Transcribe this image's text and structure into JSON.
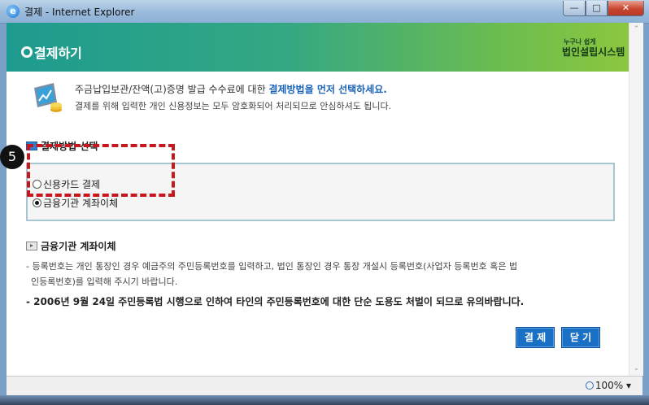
{
  "window": {
    "title": "결제 - Internet Explorer",
    "icon": "ie-icon",
    "controls": [
      "minimize-icon",
      "maximize-icon",
      "close-icon"
    ]
  },
  "header": {
    "title": "결제하기",
    "logo_small": "누구나 쉽게",
    "logo_main": "법인설립시스템"
  },
  "info": {
    "line1_prefix": "주금납입보관/잔액(고)증명 발급 수수료에 대한 ",
    "line1_highlight": "결제방법을 먼저 선택하세요.",
    "line2": "결제를 위해 입력한 개인 신용정보는 모두 암호화되어 처리되므로 안심하셔도 됩니다."
  },
  "payment_method": {
    "heading": "결제방법 선택",
    "options": [
      {
        "label": "신용카드 결제",
        "selected": false
      },
      {
        "label": "금융기관 계좌이체",
        "selected": true
      }
    ],
    "step_number": "5"
  },
  "transfer": {
    "heading": "금융기관 계좌이체",
    "desc_line1": "- 등록번호는 개인 통장인 경우 예금주의 주민등록번호를 입력하고, 법인 통장인 경우 통장 개설시 등록번호(사업자 등록번호 혹은 법",
    "desc_line2": "  인등록번호)를 입력해 주시기 바랍니다.",
    "notice": "- 2006년 9월 24일 주민등록법 시행으로 인하여 타인의 주민등록번호에 대한 단순 도용도 처벌이 되므로 유의바랍니다."
  },
  "buttons": {
    "pay": "결 제",
    "close": "닫 기"
  },
  "status": {
    "zoom": "100%"
  },
  "colors": {
    "header_start": "#1e9b8f",
    "header_end": "#8cc63f",
    "highlight_text": "#1a63b8",
    "button_bg": "#1a70c4",
    "annotation_red": "#c8161d"
  }
}
